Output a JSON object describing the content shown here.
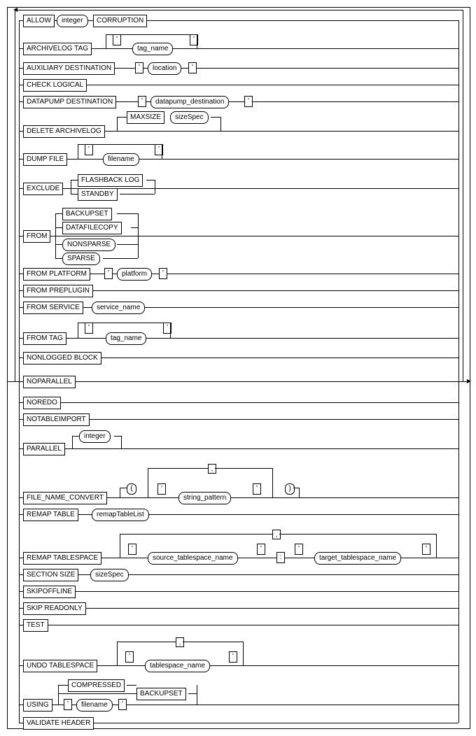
{
  "diagram_type": "syntax_railroad",
  "clauses": {
    "allow": {
      "kw1": "ALLOW",
      "nt": "integer",
      "kw2": "CORRUPTION"
    },
    "archivelog_tag": {
      "kw": "ARCHIVELOG TAG",
      "nt": "tag_name"
    },
    "aux_dest": {
      "kw": "AUXILIARY DESTINATION",
      "nt": "location"
    },
    "check_logical": {
      "kw": "CHECK LOGICAL"
    },
    "datapump_dest": {
      "kw": "DATAPUMP DESTINATION",
      "nt": "datapump_destination"
    },
    "delete_archivelog": {
      "kw": "DELETE ARCHIVELOG",
      "kw_max": "MAXSIZE",
      "nt": "sizeSpec"
    },
    "dump_file": {
      "kw": "DUMP FILE",
      "nt": "filename"
    },
    "exclude": {
      "kw": "EXCLUDE",
      "opt1": "FLASHBACK LOG",
      "opt2": "STANDBY"
    },
    "from": {
      "kw": "FROM",
      "opt1": "BACKUPSET",
      "opt2": "DATAFILECOPY",
      "opt3": "NONSPARSE",
      "opt4": "SPARSE"
    },
    "from_platform": {
      "kw": "FROM PLATFORM",
      "nt": "platform"
    },
    "from_preplugin": {
      "kw": "FROM PREPLUGIN"
    },
    "from_service": {
      "kw": "FROM SERVICE",
      "nt": "service_name"
    },
    "from_tag": {
      "kw": "FROM TAG",
      "nt": "tag_name"
    },
    "nonlogged": {
      "kw": "NONLOGGED BLOCK"
    },
    "noparallel": {
      "kw": "NOPARALLEL"
    },
    "noredo": {
      "kw": "NOREDO"
    },
    "notableimport": {
      "kw": "NOTABLEIMPORT"
    },
    "parallel": {
      "kw": "PARALLEL",
      "nt": "integer"
    },
    "file_name_convert": {
      "kw": "FILE_NAME_CONVERT",
      "nt": "string_pattern"
    },
    "remap_table": {
      "kw": "REMAP TABLE",
      "nt": "remapTableList"
    },
    "remap_tablespace": {
      "kw": "REMAP TABLESPACE",
      "nt1": "source_tablespace_name",
      "nt2": "target_tablespace_name"
    },
    "section_size": {
      "kw": "SECTION SIZE",
      "nt": "sizeSpec"
    },
    "skipoffline": {
      "kw": "SKIPOFFLINE"
    },
    "skip_readonly": {
      "kw": "SKIP READONLY"
    },
    "test": {
      "kw": "TEST"
    },
    "undo_tablespace": {
      "kw": "UNDO TABLESPACE",
      "nt": "tablespace_name"
    },
    "using": {
      "kw": "USING",
      "opt1": "COMPRESSED",
      "opt2": "BACKUPSET",
      "nt": "filename"
    },
    "validate_header": {
      "kw": "VALIDATE HEADER"
    }
  },
  "symbols": {
    "quote": "'",
    "comma": ",",
    "lparen": "(",
    "rparen": ")",
    "colon": ":"
  }
}
